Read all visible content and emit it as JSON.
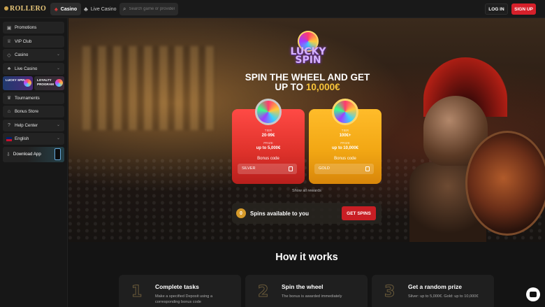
{
  "topbar": {
    "logo": "ROLLERO",
    "tabs": [
      {
        "label": "Casino",
        "active": true,
        "icon": "casino-chip-icon"
      },
      {
        "label": "Live Casino",
        "active": false,
        "icon": "live-dealer-icon"
      }
    ],
    "search_placeholder": "Search game or provider",
    "login_label": "LOG IN",
    "signup_label": "SIGN UP"
  },
  "sidebar": {
    "items": [
      {
        "label": "Promotions",
        "icon": "gift-icon"
      },
      {
        "label": "VIP Club",
        "icon": "crown-icon"
      },
      {
        "label": "Casino",
        "icon": "diamond-icon",
        "chevron": true
      },
      {
        "label": "Live Casino",
        "icon": "live-dealer-icon",
        "chevron": true
      }
    ],
    "promo_cards": [
      {
        "label_line1": "LUCKY SPIN",
        "label_line2": ""
      },
      {
        "label_line1": "LOYALTY",
        "label_line2": "PROGRAM"
      }
    ],
    "items2": [
      {
        "label": "Tournaments",
        "icon": "trophy-icon"
      },
      {
        "label": "Bonus Store",
        "icon": "store-icon"
      },
      {
        "label": "Help Center",
        "icon": "help-icon",
        "chevron": true
      },
      {
        "label": "English",
        "icon": "uk-flag-icon",
        "chevron": true
      }
    ],
    "download_label": "Download App"
  },
  "hero": {
    "logo_text_1": "LUCKY",
    "logo_text_2": "SPIN",
    "headline_1": "SPIN THE WHEEL AND GET",
    "headline_2_prefix": "UP TO ",
    "headline_2_amount": "10,000€",
    "cards": [
      {
        "tier_label": "TIER",
        "tier_value": "20-99€",
        "prize_label": "PRIZE",
        "prize_value": "up to 5,000€",
        "bonus_code_label": "Bonus code",
        "code": "SILVER"
      },
      {
        "tier_label": "TIER",
        "tier_value": "100€+",
        "prize_label": "PRIZE",
        "prize_value": "up to 10,000€",
        "bonus_code_label": "Bonus code",
        "code": "GOLD"
      }
    ],
    "show_all": "Show all rewards",
    "spins_count": "0",
    "spins_label": "Spins available to you",
    "get_spins": "GET SPINS"
  },
  "how": {
    "title": "How it works",
    "steps": [
      {
        "num": "1",
        "title": "Complete tasks",
        "desc": "Make a specified Deposit using a corresponding bonus code"
      },
      {
        "num": "2",
        "title": "Spin the wheel",
        "desc": "The bonus is awarded immediately"
      },
      {
        "num": "3",
        "title": "Get a random prize",
        "desc": "Silver: up to 5,000€. Gold: up to 10,000€"
      }
    ]
  },
  "colors": {
    "accent_red": "#d6202a",
    "gold": "#f7c43a",
    "silver_card": "#e0332c",
    "gold_card": "#f2a714"
  }
}
